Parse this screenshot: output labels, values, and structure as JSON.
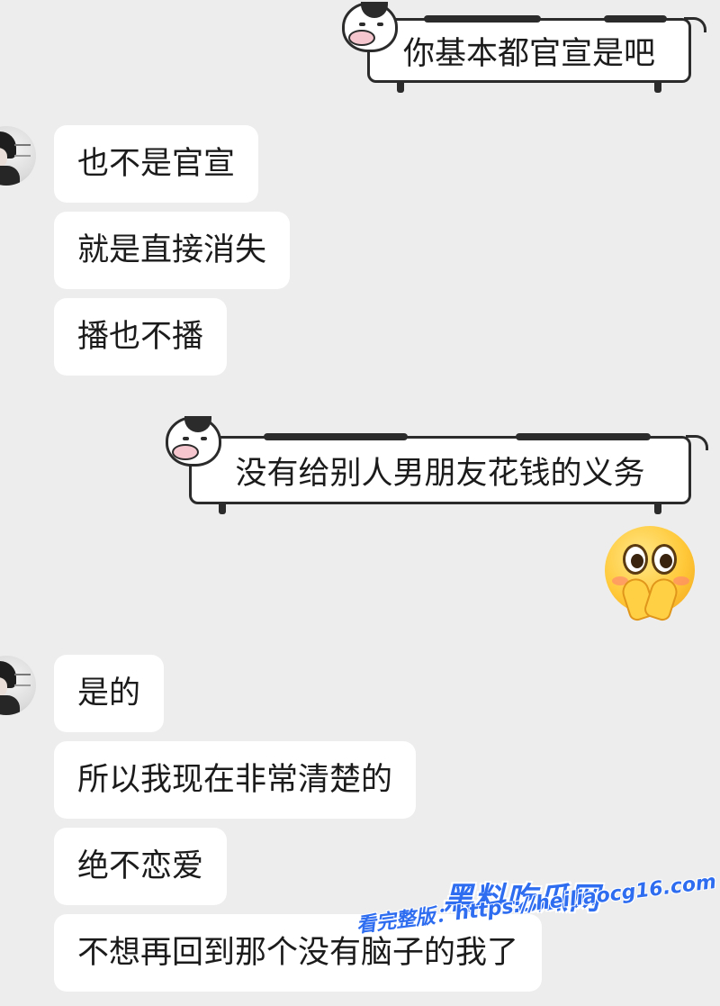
{
  "messages": [
    {
      "side": "right",
      "style": "cow",
      "text": "你基本都官宣是吧"
    },
    {
      "side": "left",
      "text": "也不是官宣"
    },
    {
      "side": "left",
      "text": "就是直接消失"
    },
    {
      "side": "left",
      "text": "播也不播"
    },
    {
      "side": "right",
      "style": "cow",
      "text": "没有给别人男朋友花钱的义务"
    },
    {
      "side": "right",
      "type": "emoji",
      "icon": "pleading-face-emoji"
    },
    {
      "side": "left",
      "text": "是的"
    },
    {
      "side": "left",
      "text": "所以我现在非常清楚的"
    },
    {
      "side": "left",
      "text": "绝不恋爱"
    },
    {
      "side": "left",
      "text": "不想再回到那个没有脑子的我了"
    }
  ],
  "watermark": {
    "logo": "黑料吃瓜网",
    "url": "看完整版：https://heiliaocg16.com"
  },
  "colors": {
    "background": "#ededed",
    "bubble": "#ffffff",
    "watermark": "#2f6df0"
  }
}
